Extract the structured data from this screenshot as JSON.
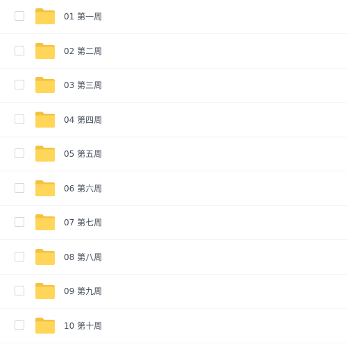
{
  "folders": [
    {
      "name": "01 第一周",
      "icon": "folder-icon"
    },
    {
      "name": "02 第二周",
      "icon": "folder-icon"
    },
    {
      "name": "03 第三周",
      "icon": "folder-icon"
    },
    {
      "name": "04 第四周",
      "icon": "folder-icon"
    },
    {
      "name": "05 第五周",
      "icon": "folder-icon"
    },
    {
      "name": "06 第六周",
      "icon": "folder-icon"
    },
    {
      "name": "07 第七周",
      "icon": "folder-icon"
    },
    {
      "name": "08 第八周",
      "icon": "folder-icon"
    },
    {
      "name": "09 第九周",
      "icon": "folder-icon"
    },
    {
      "name": "10 第十周",
      "icon": "folder-icon"
    }
  ],
  "colors": {
    "folder_back": "#f5c142",
    "folder_front": "#ffd659",
    "text": "#454d5a",
    "divider": "#f2f3f5",
    "checkbox_border": "#d3d7de"
  }
}
